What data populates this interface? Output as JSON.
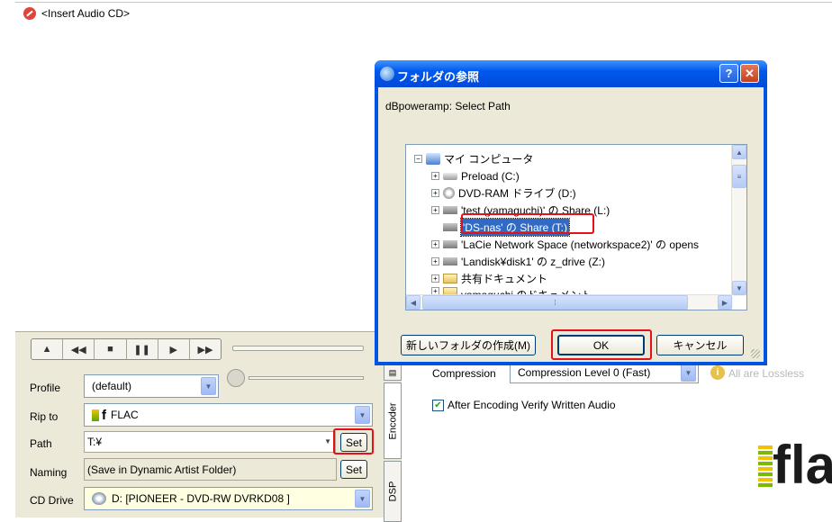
{
  "cd_header": {
    "text": "<Insert Audio CD>"
  },
  "transport": {
    "buttons": [
      "▲",
      "◀◀",
      "■",
      "❚❚",
      "▶",
      "▶▶"
    ]
  },
  "form": {
    "profile_label": "Profile",
    "profile_value": "(default)",
    "ripto_label": "Rip to",
    "ripto_value": "FLAC",
    "path_label": "Path",
    "path_value": "T:¥",
    "path_set": "Set",
    "naming_label": "Naming",
    "naming_value": "(Save in Dynamic Artist Folder)",
    "naming_set": "Set",
    "cddrive_label": "CD Drive",
    "cddrive_value": "D:  [PIONEER  - DVD-RW  DVRKD08 ]"
  },
  "tabs": {
    "encoder": "Encoder",
    "dsp": "DSP"
  },
  "encoder": {
    "compression_label": "Compression",
    "compression_value": "Compression Level 0  (Fast)",
    "lossless_note": "All are Lossless",
    "verify_label": "After Encoding Verify Written Audio",
    "logo": "fla"
  },
  "dialog": {
    "title": "フォルダの参照",
    "prompt": "dBpoweramp: Select Path",
    "tree": [
      {
        "label": "マイ コンピュータ",
        "icon": "computer-icon"
      },
      {
        "label": "Preload (C:)",
        "icon": "drive-icon"
      },
      {
        "label": "DVD-RAM ドライブ (D:)",
        "icon": "dvd-drive-icon"
      },
      {
        "label": "'test (yamaguchi)' の Share (L:)",
        "icon": "network-drive-icon"
      },
      {
        "label": "'DS-nas' の Share (T:)",
        "icon": "network-drive-icon"
      },
      {
        "label": "'LaCie Network Space (networkspace2)' の opens",
        "icon": "network-drive-icon"
      },
      {
        "label": "'Landisk¥disk1' の z_drive (Z:)",
        "icon": "network-drive-icon"
      },
      {
        "label": "共有ドキュメント",
        "icon": "folder-icon"
      },
      {
        "label": "yamaguchi のドキュメント",
        "icon": "folder-icon"
      }
    ],
    "new_folder": "新しいフォルダの作成(M)",
    "ok": "OK",
    "cancel": "キャンセル",
    "help": "?",
    "close": "✕"
  }
}
